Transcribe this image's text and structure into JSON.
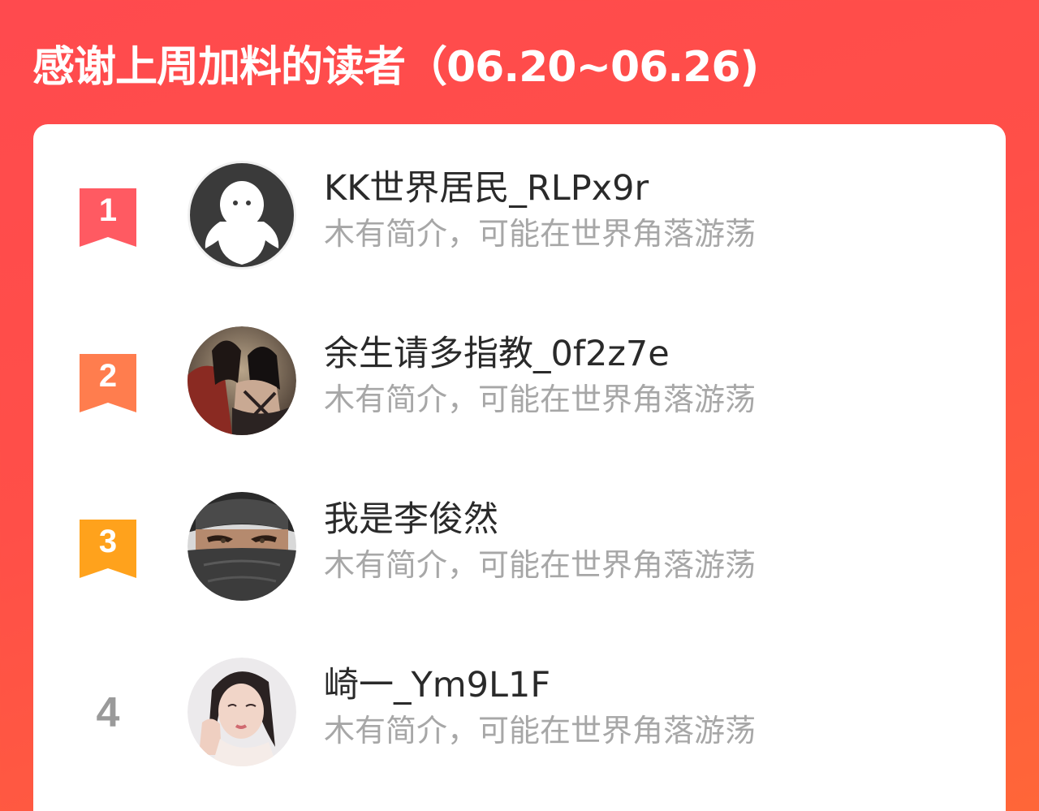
{
  "header": {
    "title": "感谢上周加料的读者（06.20~06.26)"
  },
  "colors": {
    "background_start": "#ff4a4e",
    "background_end": "#ff6638",
    "rank1": "#ff5a62",
    "rank2": "#ff7d4e",
    "rank3": "#ffa21c",
    "rank_plain": "#9a9a9a",
    "name": "#2a2a2a",
    "bio": "#a7a7a7"
  },
  "readers": [
    {
      "rank": "1",
      "name": "KK世界居民_RLPx9r",
      "bio": "木有简介，可能在世界角落游荡",
      "avatar_icon": "default-ghost-avatar"
    },
    {
      "rank": "2",
      "name": "余生请多指教_0f2z7e",
      "bio": "木有简介，可能在世界角落游荡",
      "avatar_icon": "anime-couple-avatar"
    },
    {
      "rank": "3",
      "name": "我是李俊然",
      "bio": "木有简介，可能在世界角落游荡",
      "avatar_icon": "masked-ninja-avatar"
    },
    {
      "rank": "4",
      "name": "崎一_Ym9L1F",
      "bio": "木有简介，可能在世界角落游荡",
      "avatar_icon": "girl-portrait-avatar"
    }
  ]
}
